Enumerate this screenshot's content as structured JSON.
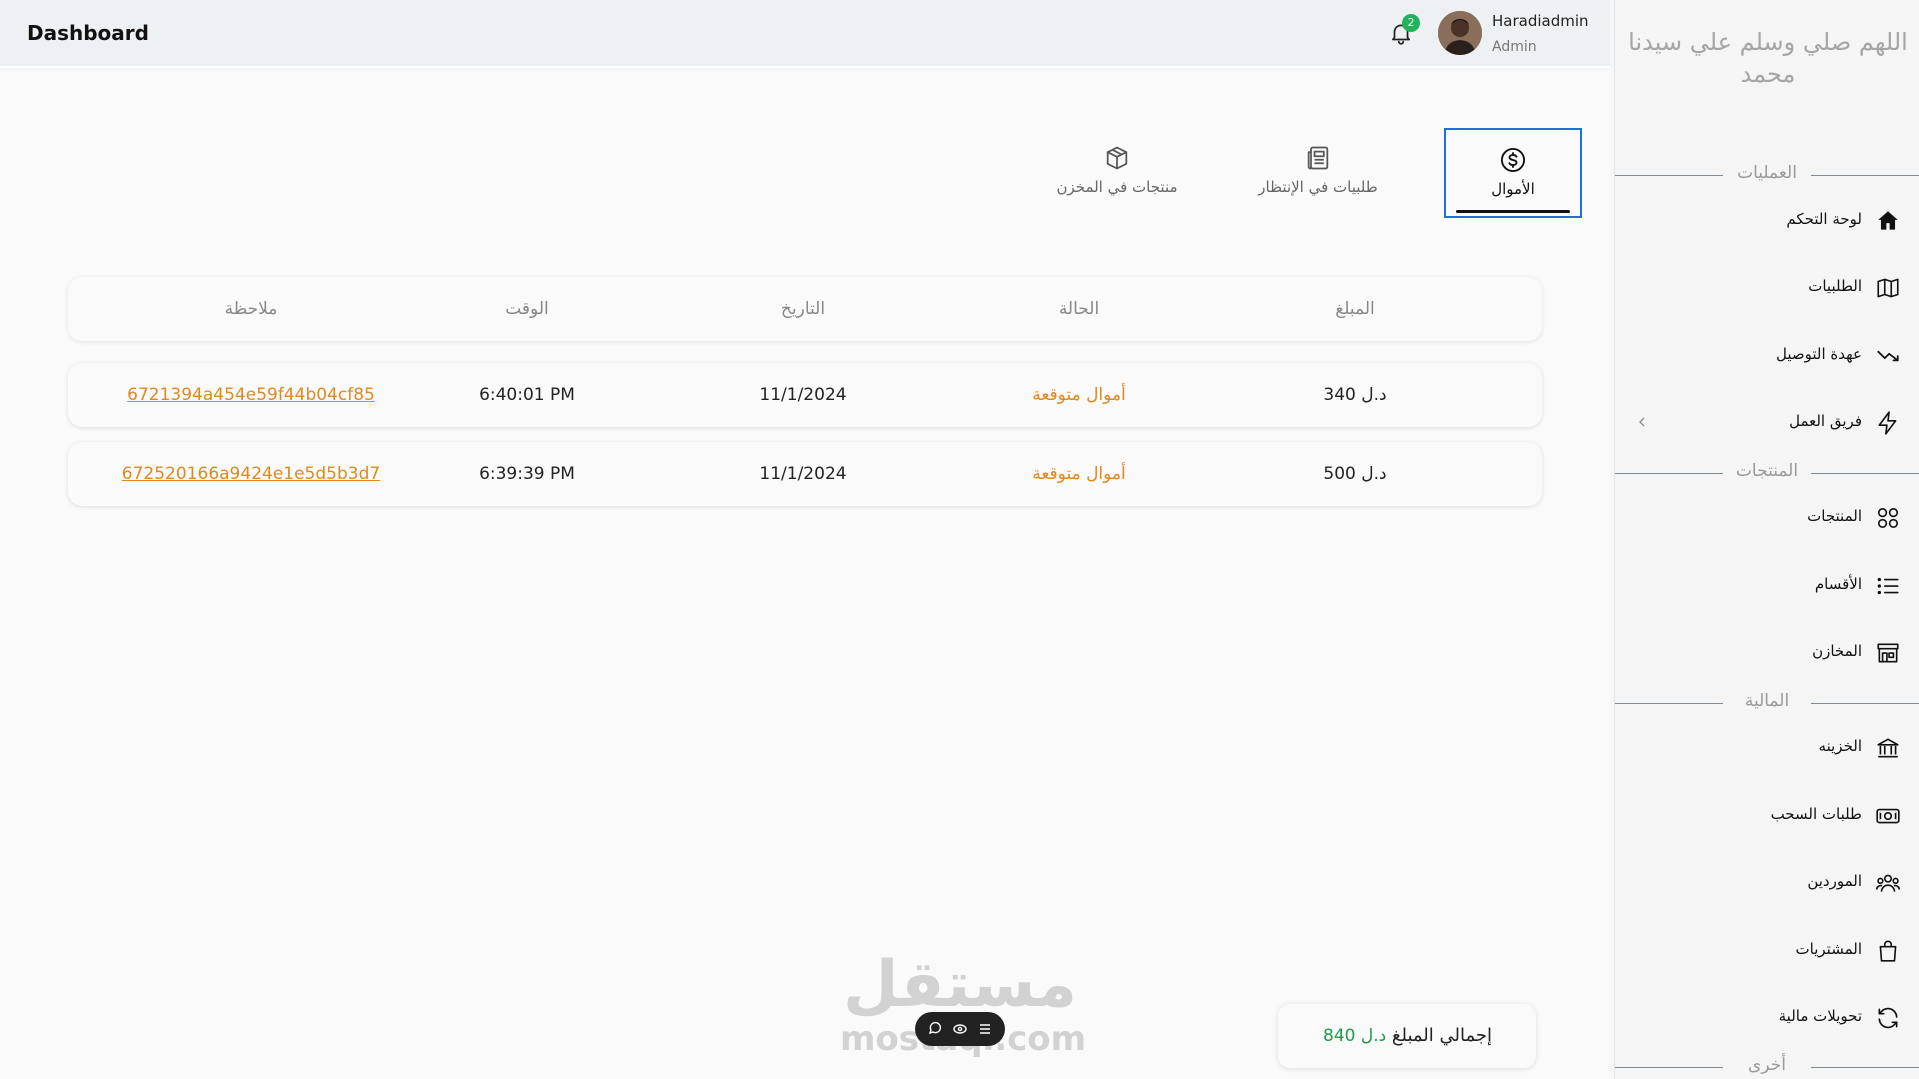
{
  "header": {
    "title": "Dashboard",
    "notification_count": "2",
    "user_name": "Haradiadmin",
    "user_role": "Admin"
  },
  "tabs": [
    {
      "label": "الأموال",
      "icon": "dollar-icon",
      "active": true
    },
    {
      "label": "طلبيات في الإنتظار",
      "icon": "newspaper-icon",
      "active": false
    },
    {
      "label": "منتجات في المخزن",
      "icon": "box-icon",
      "active": false
    }
  ],
  "table": {
    "columns": [
      "المبلغ",
      "الحالة",
      "التاريخ",
      "الوقت",
      "ملاحظة"
    ],
    "rows": [
      {
        "amount": "340 د.ل",
        "status": "أموال متوقعة",
        "date": "11/1/2024",
        "time": "6:40:01 PM",
        "note": "6721394a454e59f44b04cf85"
      },
      {
        "amount": "500 د.ل",
        "status": "أموال متوقعة",
        "date": "11/1/2024",
        "time": "6:39:39 PM",
        "note": "672520166a9424e1e5d5b3d7"
      }
    ]
  },
  "total": {
    "label": "إجمالي المبلغ",
    "value": "840 د.ل"
  },
  "watermark": {
    "arabic": "مستقل",
    "latin": "mostaql.com"
  },
  "sidebar": {
    "brand": "اللهم صلي وسلم علي سيدنا محمد",
    "sections": {
      "operations": "العمليات",
      "products": "المنتجات",
      "finance": "المالية",
      "other": "أخرى"
    },
    "items": [
      {
        "label": "لوحة التحكم",
        "icon": "home-icon"
      },
      {
        "label": "الطلبيات",
        "icon": "map-icon"
      },
      {
        "label": "عهدة التوصيل",
        "icon": "trend-icon"
      },
      {
        "label": "فريق العمل",
        "icon": "bolt-icon"
      },
      {
        "label": "المنتجات",
        "icon": "grid-icon"
      },
      {
        "label": "الأقسام",
        "icon": "list-icon"
      },
      {
        "label": "المخازن",
        "icon": "store-icon"
      },
      {
        "label": "الخزينه",
        "icon": "bank-icon"
      },
      {
        "label": "طلبات السحب",
        "icon": "cash-icon"
      },
      {
        "label": "الموردين",
        "icon": "users-icon"
      },
      {
        "label": "المشتريات",
        "icon": "bag-icon"
      },
      {
        "label": "تحويلات مالية",
        "icon": "refresh-icon"
      }
    ]
  }
}
